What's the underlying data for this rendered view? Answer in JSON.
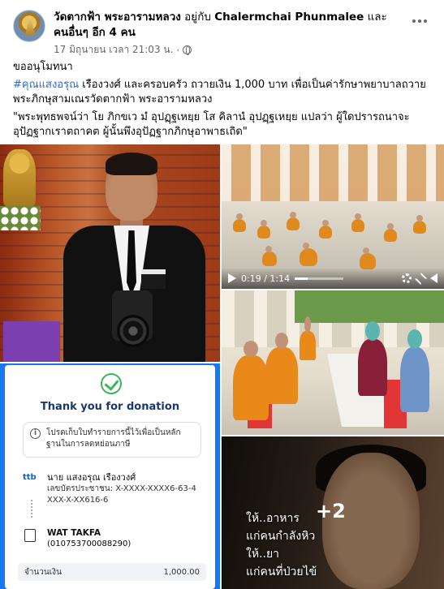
{
  "post": {
    "page_name": "วัดตากฟ้า พระอารามหลวง",
    "with_text": "อยู่กับ",
    "tagged_person": "Chalermchai Phunmalee",
    "and_text": "และ",
    "others": "คนอื่นๆ อีก 4 คน",
    "timestamp": "17 มิถุนายน เวลา 21:03 น.",
    "separator": "·",
    "text_line1": "ขออนุโมทนา",
    "hashtag": "#คุณแสงอรุณ",
    "text_line2": " เรืองวงศ์ และครอบครัว ถวายเงิน  1,000 บาท เพื่อเป็นค่ารักษาพยาบาลถวายพระภิกษุสามเณรวัดตากฟ้า พระอารามหลวง",
    "quote": "\"พระพุทธพจน์ว่า โย ภิกขเว มํ อุปฏฺฐเหยฺย โส คิลานํ อุปฏฺฐเหยฺย แปลว่า ผู้ใดปรารถนาจะอุปัฏฐากเราตถาคต ผู้นั้นพึงอุปัฏฐากภิกษุอาพาธเถิด\""
  },
  "video": {
    "time": "0:19 / 1:14",
    "progress": 0.26
  },
  "receipt": {
    "title": "Thank you for donation",
    "info": "โปรดเก็บใบทำรายการนี้ไว้เพื่อเป็นหลักฐานในการลดหย่อนภาษี",
    "bank_logo": "ttb",
    "from_name": "นาย แสงอรุณ เรืองวงศ์",
    "from_id": "เลขบัตรประชาชน: X-XXXX-XXXX6-63-4",
    "from_account": "XXX-X-XX616-6",
    "to_name": "WAT TAKFA",
    "to_id": "(010753700088290)",
    "amount_label": "จำนวนเงิน",
    "amount_value": "1,000.00"
  },
  "meme": {
    "more_count": "+2",
    "caption_line1": "ให้..อาหาร",
    "caption_line2": "แก่คนกำลังหิว",
    "caption_line3": "ให้..ยา",
    "caption_line4": "แก่คนที่ป่วยไข้"
  },
  "colors": {
    "link": "#216fdb",
    "brand_blue": "#1877f2",
    "success_green": "#3cb55c",
    "robe_orange": "#e8891a"
  },
  "icons": [
    "globe-icon",
    "more-icon",
    "play-icon",
    "gear-icon",
    "expand-icon",
    "volume-icon",
    "check-icon",
    "info-icon",
    "receipt-icon"
  ]
}
